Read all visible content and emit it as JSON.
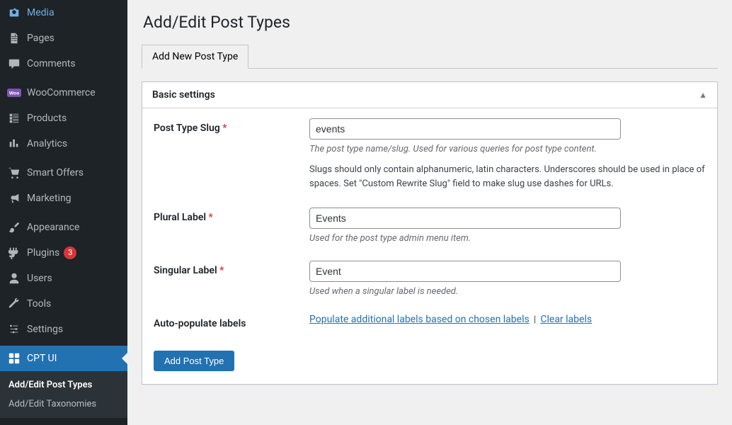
{
  "sidebar": {
    "items": [
      {
        "label": "Media",
        "icon": "media"
      },
      {
        "label": "Pages",
        "icon": "pages"
      },
      {
        "label": "Comments",
        "icon": "comments"
      },
      {
        "sep": true
      },
      {
        "label": "WooCommerce",
        "icon": "woo"
      },
      {
        "label": "Products",
        "icon": "products"
      },
      {
        "label": "Analytics",
        "icon": "analytics"
      },
      {
        "sep": true
      },
      {
        "label": "Smart Offers",
        "icon": "cart"
      },
      {
        "label": "Marketing",
        "icon": "megaphone"
      },
      {
        "sep": true
      },
      {
        "label": "Appearance",
        "icon": "brush"
      },
      {
        "label": "Plugins",
        "icon": "plugin",
        "badge": "3"
      },
      {
        "label": "Users",
        "icon": "users"
      },
      {
        "label": "Tools",
        "icon": "wrench"
      },
      {
        "label": "Settings",
        "icon": "settings"
      },
      {
        "sep": true
      },
      {
        "label": "CPT UI",
        "icon": "cptui",
        "active": true
      }
    ],
    "submenu": [
      {
        "label": "Add/Edit Post Types",
        "active": true
      },
      {
        "label": "Add/Edit Taxonomies"
      }
    ]
  },
  "page": {
    "title": "Add/Edit Post Types",
    "tabs": [
      {
        "label": "Add New Post Type",
        "active": true
      }
    ],
    "section_title": "Basic settings",
    "fields": {
      "slug": {
        "label": "Post Type Slug",
        "required": "*",
        "value": "events",
        "desc": "The post type name/slug. Used for various queries for post type content.",
        "extra": "Slugs should only contain alphanumeric, latin characters. Underscores should be used in place of spaces. Set \"Custom Rewrite Slug\" field to make slug use dashes for URLs."
      },
      "plural": {
        "label": "Plural Label",
        "required": "*",
        "value": "Events",
        "desc": "Used for the post type admin menu item."
      },
      "singular": {
        "label": "Singular Label",
        "required": "*",
        "value": "Event",
        "desc": "Used when a singular label is needed."
      },
      "autopop": {
        "label": "Auto-populate labels",
        "link1": "Populate additional labels based on chosen labels",
        "link2": "Clear labels",
        "sep": "|"
      }
    },
    "submit": "Add Post Type"
  }
}
